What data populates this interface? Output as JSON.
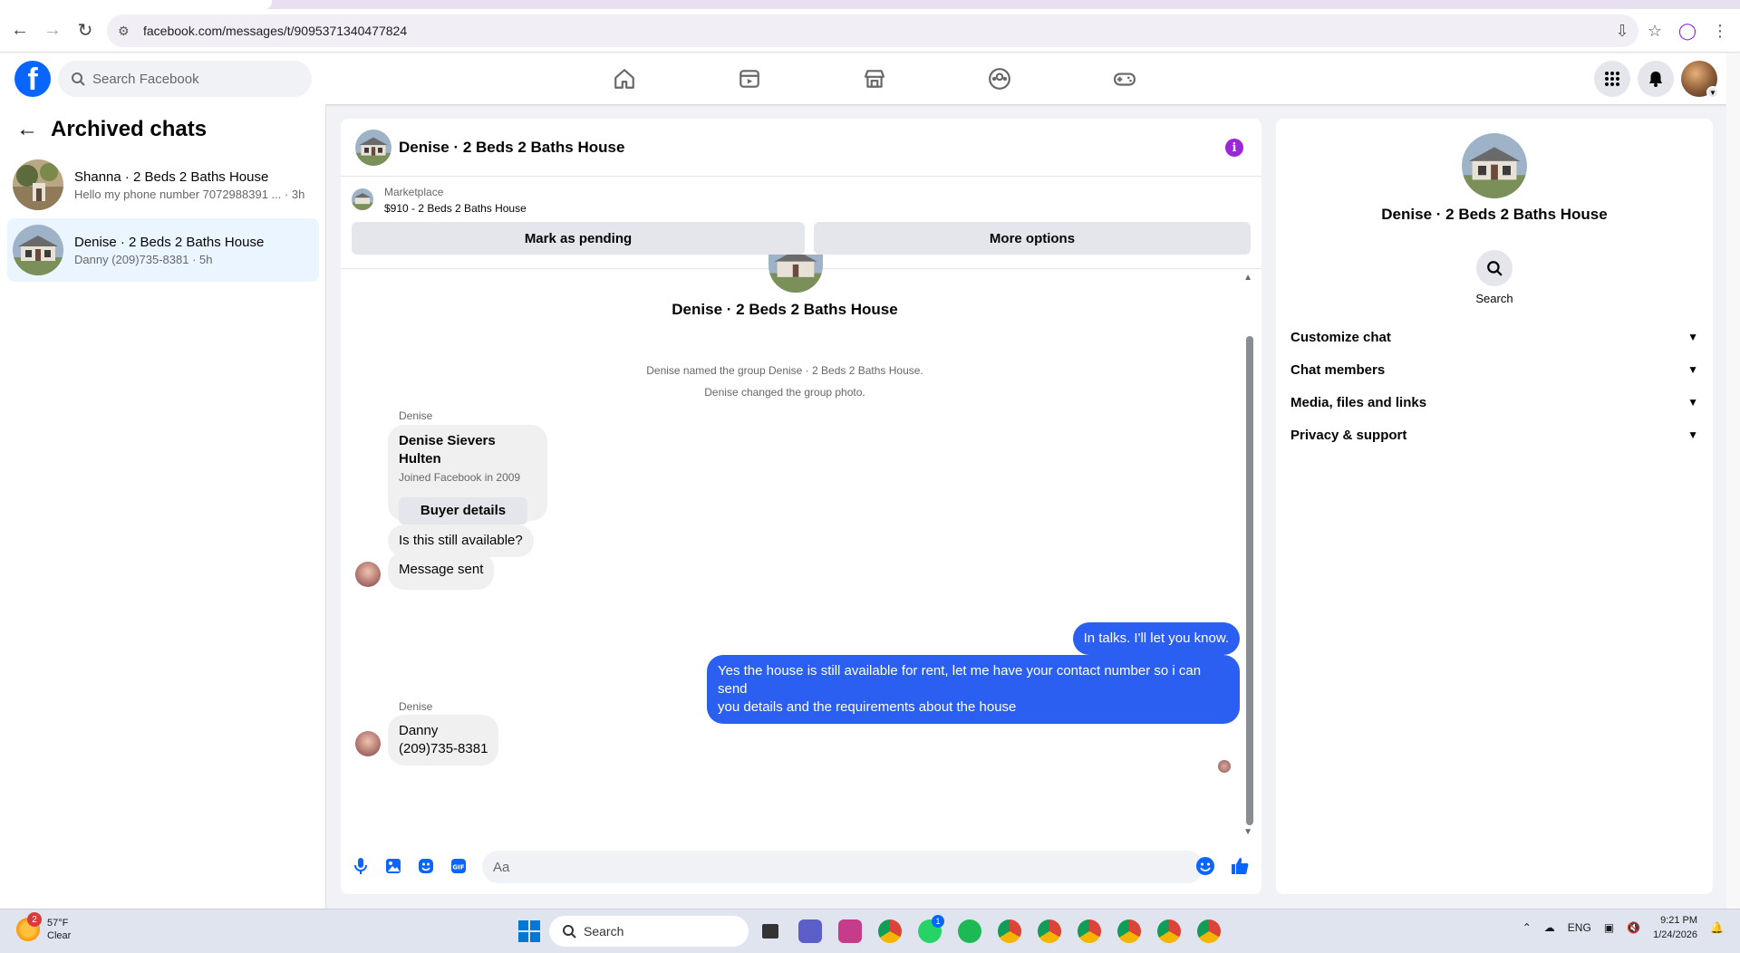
{
  "browser": {
    "url": "facebook.com/messages/t/9095371340477824"
  },
  "fb": {
    "search_placeholder": "Search Facebook"
  },
  "sidebar": {
    "title": "Archived chats",
    "chats": [
      {
        "name": "Shanna · 2 Beds 2 Baths House",
        "preview": "Hello my phone number 7072988391 ... · 3h"
      },
      {
        "name": "Denise · 2 Beds 2 Baths House",
        "preview": "Danny (209)735-8381 · 5h"
      }
    ]
  },
  "chat": {
    "title": "Denise · 2 Beds 2 Baths House",
    "marketplace_label": "Marketplace",
    "marketplace_item": "$910 - 2 Beds 2 Baths House",
    "mark_pending": "Mark as pending",
    "more_options": "More options",
    "group_title": "Denise · 2 Beds 2 Baths House",
    "system_msgs": [
      "Denise named the group Denise · 2 Beds 2 Baths House.",
      "Denise changed the group photo."
    ],
    "sender1": "Denise",
    "buyer_card": {
      "name": "Denise Sievers Hulten",
      "joined": "Joined Facebook in 2009",
      "button": "Buyer details"
    },
    "incoming1": "Is this still available?",
    "incoming2": "Message sent",
    "outgoing1": "In talks. I'll let you know.",
    "outgoing2_line1": "Yes the house is still available for rent, let me have your contact number so i can send",
    "outgoing2_line2": "you details and the requirements about the house",
    "sender2": "Denise",
    "incoming3_line1": "Danny",
    "incoming3_line2": "(209)735-8381",
    "composer_placeholder": "Aa"
  },
  "right_panel": {
    "name": "Denise · 2 Beds 2 Baths House",
    "search_label": "Search",
    "items": [
      "Customize chat",
      "Chat members",
      "Media, files and links",
      "Privacy & support"
    ]
  },
  "taskbar": {
    "temp": "57°F",
    "condition": "Clear",
    "weather_badge": "2",
    "search": "Search",
    "lang": "ENG",
    "time": "9:21 PM",
    "date": "1/24/2026",
    "whatsapp_badge": "1"
  },
  "colors": {
    "fb_blue": "#0866ff",
    "messenger_out": "#2b5ff2",
    "info_purple": "#9b27d8"
  }
}
